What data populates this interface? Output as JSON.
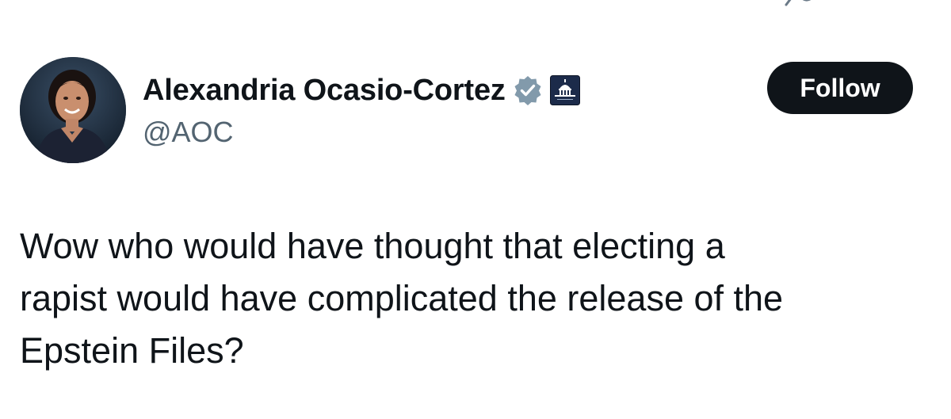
{
  "tweet": {
    "author": {
      "display_name": "Alexandria Ocasio-Cortez",
      "handle": "@AOC",
      "verified_icon": "verified-badge-icon",
      "affiliation_icon": "capitol-building-icon"
    },
    "follow_button_label": "Follow",
    "text_lines": [
      "Wow who would have thought that electing a",
      "rapist would have complicated the release of the",
      "Epstein Files?"
    ]
  },
  "colors": {
    "text_primary": "#0f1419",
    "text_secondary": "#536471",
    "verified_badge": "#829aab",
    "follow_button_bg": "#0f1419",
    "affiliation_badge_bg": "#1c2b4a"
  }
}
